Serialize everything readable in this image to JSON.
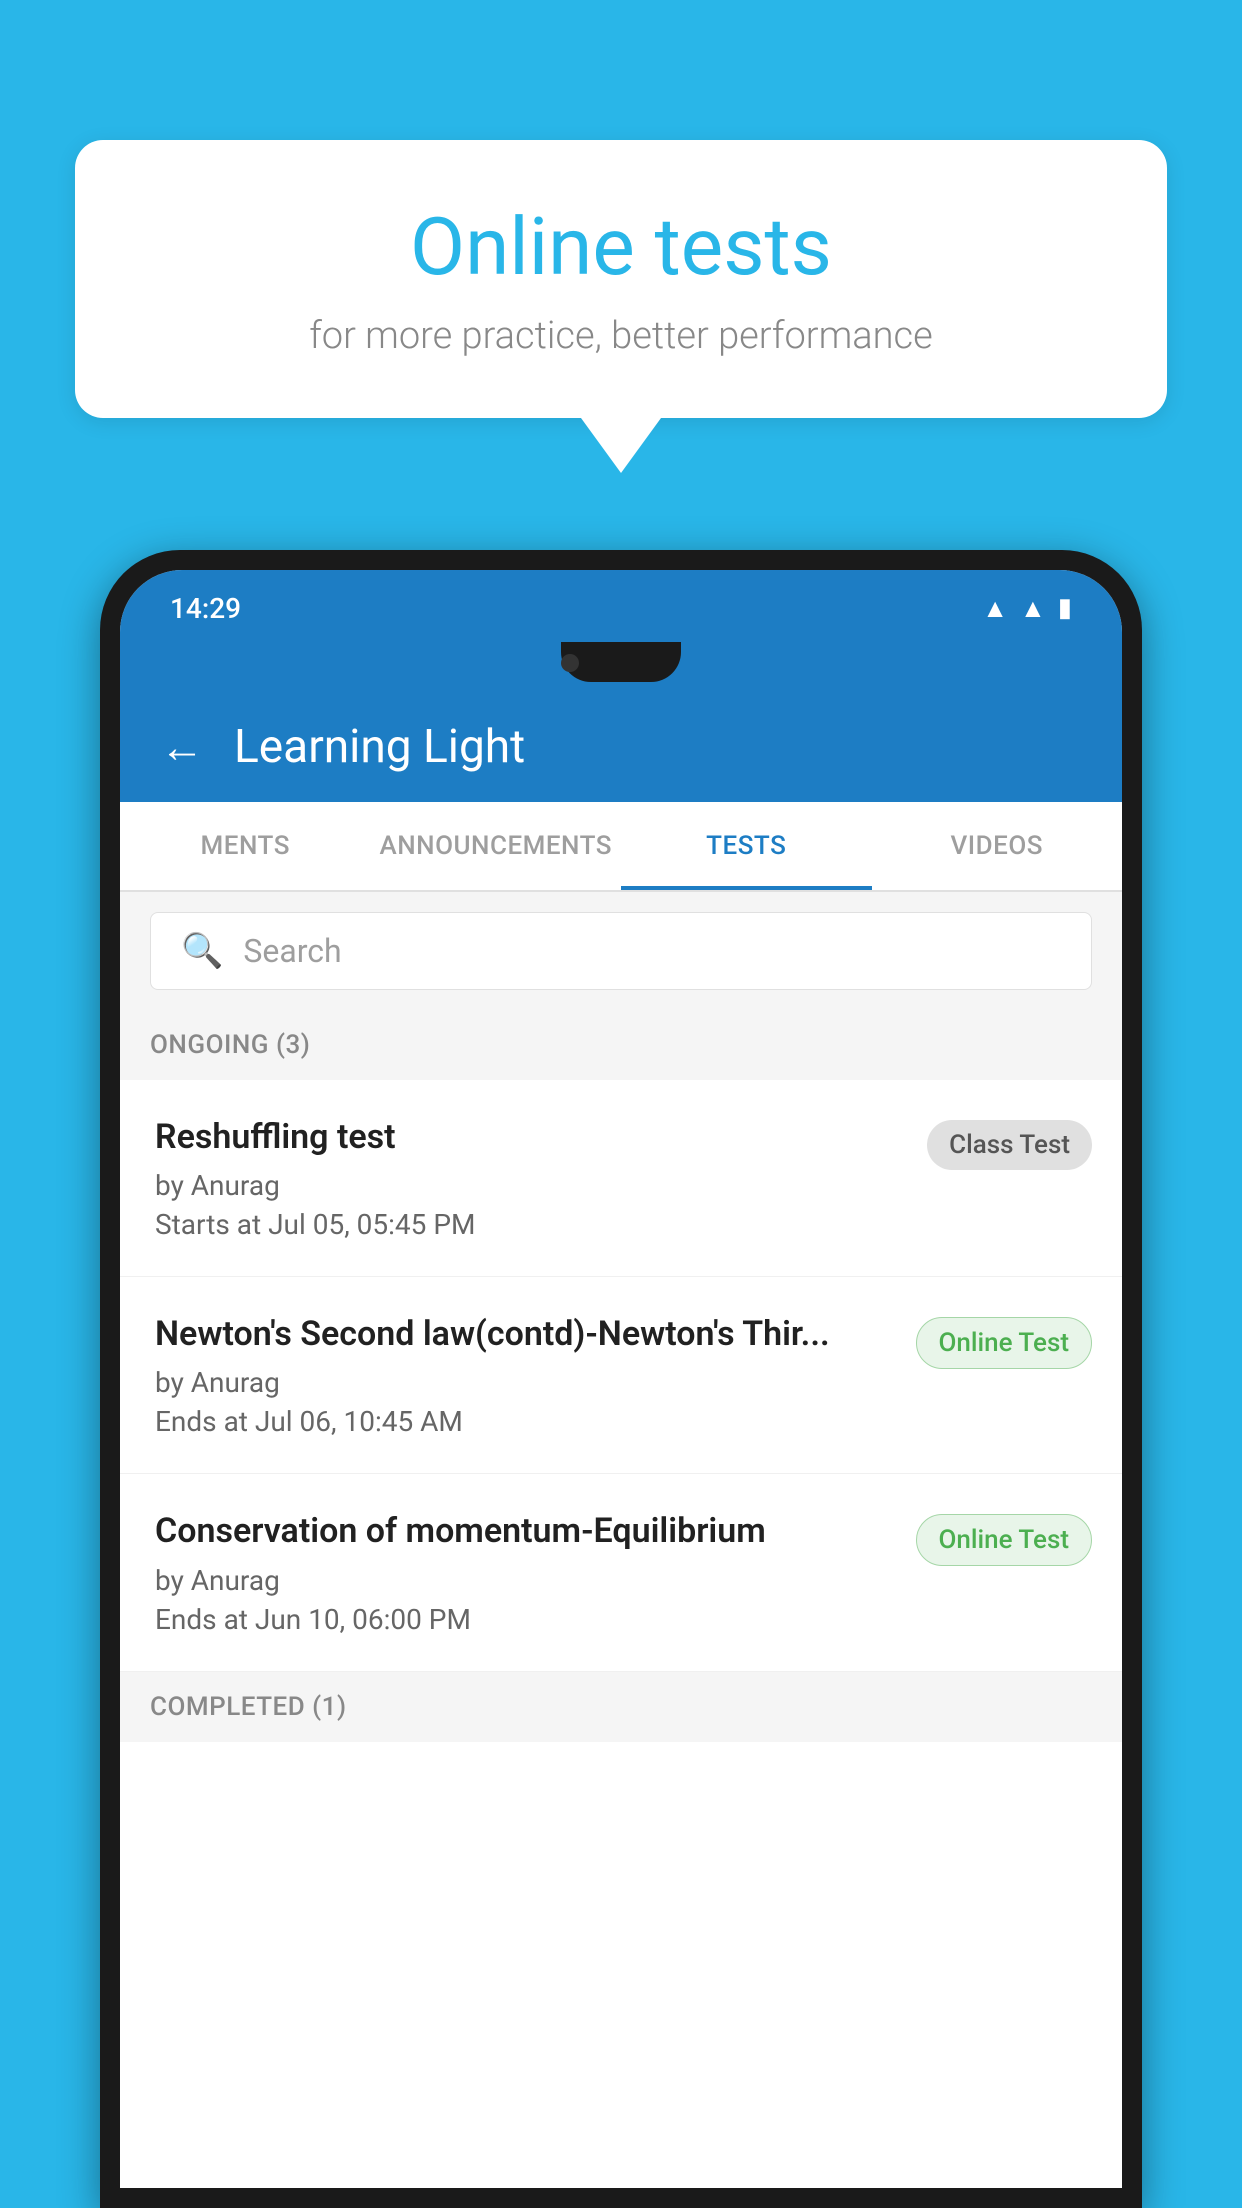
{
  "background_color": "#29b6e8",
  "speech_bubble": {
    "title": "Online tests",
    "subtitle": "for more practice, better performance"
  },
  "status_bar": {
    "time": "14:29",
    "icons": [
      "wifi",
      "signal",
      "battery"
    ]
  },
  "app_bar": {
    "title": "Learning Light",
    "back_label": "←"
  },
  "tabs": [
    {
      "label": "MENTS",
      "active": false
    },
    {
      "label": "ANNOUNCEMENTS",
      "active": false
    },
    {
      "label": "TESTS",
      "active": true
    },
    {
      "label": "VIDEOS",
      "active": false
    }
  ],
  "search": {
    "placeholder": "Search"
  },
  "ongoing_section": {
    "label": "ONGOING (3)"
  },
  "test_items": [
    {
      "name": "Reshuffling test",
      "author": "by Anurag",
      "time_label": "Starts at  Jul 05, 05:45 PM",
      "badge": "Class Test",
      "badge_type": "class"
    },
    {
      "name": "Newton's Second law(contd)-Newton's Thir...",
      "author": "by Anurag",
      "time_label": "Ends at  Jul 06, 10:45 AM",
      "badge": "Online Test",
      "badge_type": "online"
    },
    {
      "name": "Conservation of momentum-Equilibrium",
      "author": "by Anurag",
      "time_label": "Ends at  Jun 10, 06:00 PM",
      "badge": "Online Test",
      "badge_type": "online"
    }
  ],
  "completed_section": {
    "label": "COMPLETED (1)"
  }
}
